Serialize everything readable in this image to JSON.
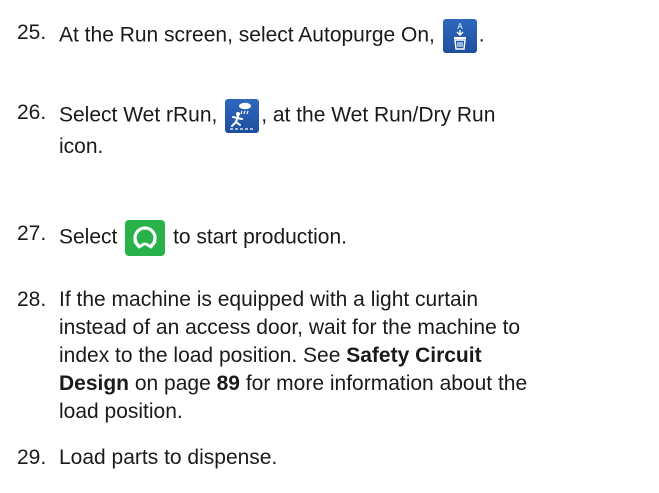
{
  "steps": [
    {
      "num": "25.",
      "parts": [
        "At the Run screen, select Autopurge On,",
        "."
      ],
      "icon": "autopurge-icon"
    },
    {
      "num": "26.",
      "parts": [
        "Select Wet rRun,",
        ", at the Wet Run/Dry Run",
        "icon."
      ],
      "icon": "wet-run-icon"
    },
    {
      "num": "27.",
      "parts": [
        "Select",
        "to start production."
      ],
      "icon": "start-cycle-icon"
    },
    {
      "num": "28.",
      "lines": [
        "If the machine is equipped with a light curtain",
        "instead of an access door, wait for the machine to",
        "index to the load position. See"
      ],
      "link_text": "Safety Circuit Design",
      "mid": "on page",
      "page": "89",
      "after": "for more information about the",
      "last_line": "load position."
    },
    {
      "num": "29.",
      "text": "Load parts to dispense."
    }
  ],
  "colors": {
    "icon_blue": "#1d4f9e",
    "icon_green": "#29b24a"
  }
}
